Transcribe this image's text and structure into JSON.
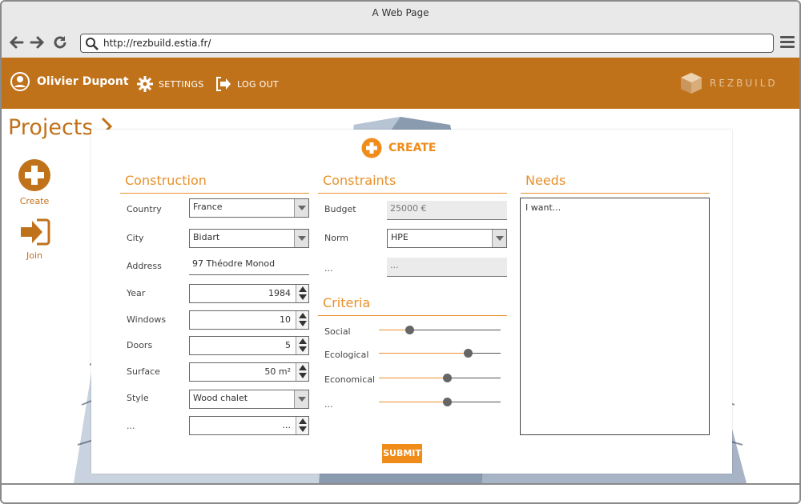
{
  "browser": {
    "window_title": "A Web Page",
    "url": "http://rezbuild.estia.fr/"
  },
  "header": {
    "user_name": "Olivier Dupont",
    "settings_label": "SETTINGS",
    "logout_label": "LOG OUT",
    "brand": "REZBUILD"
  },
  "page": {
    "title": "Projects",
    "create_label": "Create",
    "join_label": "Join"
  },
  "modal": {
    "title": "CREATE",
    "construction": {
      "heading": "Construction",
      "country_label": "Country",
      "country_value": "France",
      "city_label": "City",
      "city_value": "Bidart",
      "address_label": "Address",
      "address_value": "97 Théodre Monod",
      "year_label": "Year",
      "year_value": "1984",
      "windows_label": "Windows",
      "windows_value": "10",
      "doors_label": "Doors",
      "doors_value": "5",
      "surface_label": "Surface",
      "surface_value": "50 m²",
      "style_label": "Style",
      "style_value": "Wood chalet",
      "extra_label": "...",
      "extra_value": "..."
    },
    "constraints": {
      "heading": "Constraints",
      "budget_label": "Budget",
      "budget_value": "25000 €",
      "norm_label": "Norm",
      "norm_value": "HPE",
      "extra_label": "...",
      "extra_value": "..."
    },
    "criteria": {
      "heading": "Criteria",
      "items": [
        {
          "label": "Social",
          "level": 0.25
        },
        {
          "label": "Ecological",
          "level": 0.73
        },
        {
          "label": "Economical",
          "level": 0.56
        },
        {
          "label": "...",
          "level": 0.56
        }
      ]
    },
    "needs": {
      "heading": "Needs",
      "value": "I want..."
    },
    "submit_label": "SUBMIT"
  },
  "colors": {
    "accent": "#c0721b",
    "orange": "#f08c1a"
  }
}
